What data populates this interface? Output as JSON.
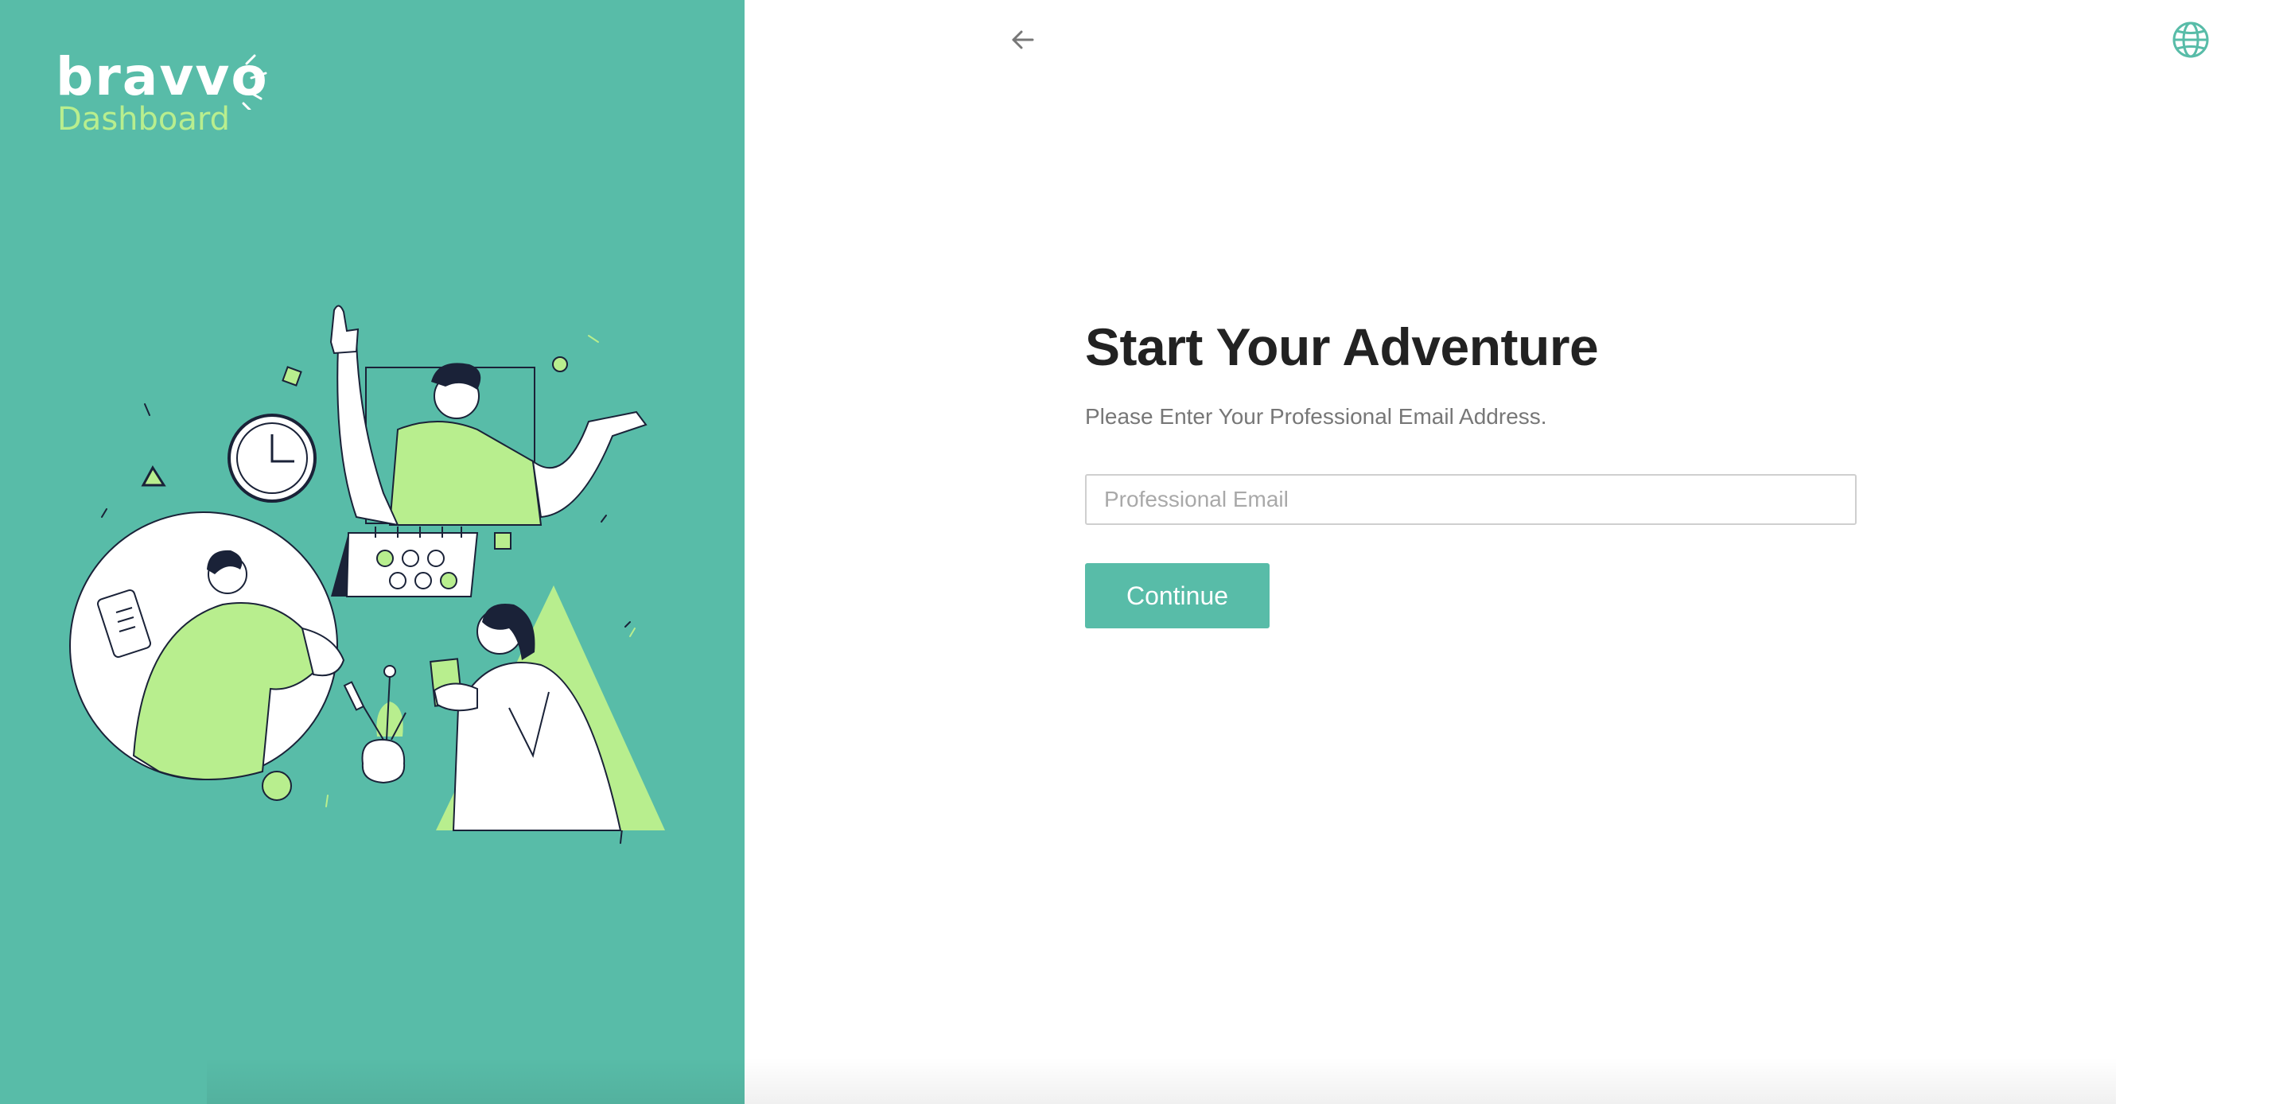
{
  "brand": {
    "name": "bravvo",
    "subtitle": "Dashboard"
  },
  "colors": {
    "primary": "#58bca8",
    "accent_light": "#b8ee8e",
    "title": "#222222",
    "muted": "#777777"
  },
  "header": {
    "back_icon": "arrow-left-icon",
    "language_icon": "globe-icon"
  },
  "form": {
    "title": "Start Your Adventure",
    "subtitle": "Please Enter Your Professional Email Address.",
    "email_value": "",
    "email_placeholder": "Professional Email",
    "continue_label": "Continue"
  }
}
